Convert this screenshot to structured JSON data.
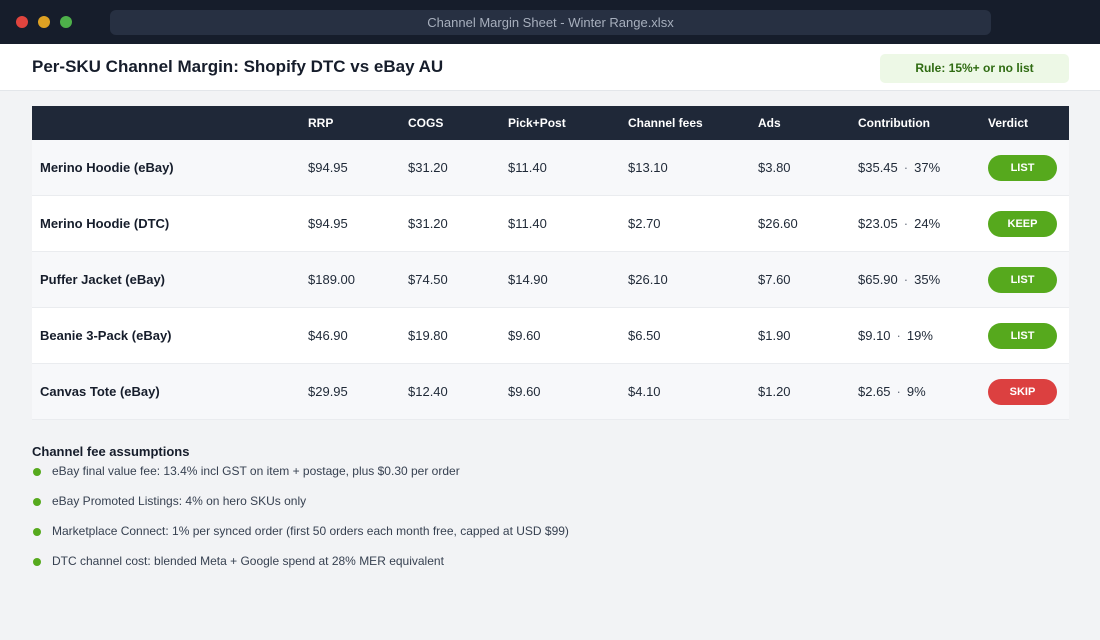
{
  "window": {
    "title": "Channel Margin Sheet - Winter Range.xlsx"
  },
  "header": {
    "title": "Per-SKU Channel Margin: Shopify DTC vs eBay AU",
    "rule": "Rule: 15%+ or no list"
  },
  "table": {
    "columns": {
      "product": "",
      "rrp": "RRP",
      "cogs": "COGS",
      "pick": "Pick+Post",
      "fees": "Channel fees",
      "ads": "Ads",
      "contribution": "Contribution",
      "verdict": "Verdict"
    },
    "rows": [
      {
        "name": "Merino Hoodie (eBay)",
        "rrp": "$94.95",
        "cogs": "$31.20",
        "pick": "$11.40",
        "fees": "$13.10",
        "ads": "$3.80",
        "contribution": "$35.45",
        "margin": "37%",
        "verdict": "LIST",
        "status": "list"
      },
      {
        "name": "Merino Hoodie (DTC)",
        "rrp": "$94.95",
        "cogs": "$31.20",
        "pick": "$11.40",
        "fees": "$2.70",
        "ads": "$26.60",
        "contribution": "$23.05",
        "margin": "24%",
        "verdict": "KEEP",
        "status": "keep"
      },
      {
        "name": "Puffer Jacket (eBay)",
        "rrp": "$189.00",
        "cogs": "$74.50",
        "pick": "$14.90",
        "fees": "$26.10",
        "ads": "$7.60",
        "contribution": "$65.90",
        "margin": "35%",
        "verdict": "LIST",
        "status": "list"
      },
      {
        "name": "Beanie 3-Pack (eBay)",
        "rrp": "$46.90",
        "cogs": "$19.80",
        "pick": "$9.60",
        "fees": "$6.50",
        "ads": "$1.90",
        "contribution": "$9.10",
        "margin": "19%",
        "verdict": "LIST",
        "status": "list"
      },
      {
        "name": "Canvas Tote (eBay)",
        "rrp": "$29.95",
        "cogs": "$12.40",
        "pick": "$9.60",
        "fees": "$4.10",
        "ads": "$1.20",
        "contribution": "$2.65",
        "margin": "9%",
        "verdict": "SKIP",
        "status": "skip"
      }
    ]
  },
  "notes": {
    "title": "Channel fee assumptions",
    "items": [
      "eBay final value fee: 13.4% incl GST on item + postage, plus $0.30 per order",
      "eBay Promoted Listings: 4% on hero SKUs only",
      "Marketplace Connect: 1% per synced order (first 50 orders each month free, capped at USD $99)",
      "DTC channel cost: blended Meta + Google spend at 28% MER equivalent"
    ]
  },
  "colors": {
    "titlebar": "#161d2b",
    "table_header": "#1f2838",
    "positive": "#56a91d",
    "negative": "#dc4040",
    "rule_badge_bg": "#edf8e6"
  },
  "separator": "·"
}
